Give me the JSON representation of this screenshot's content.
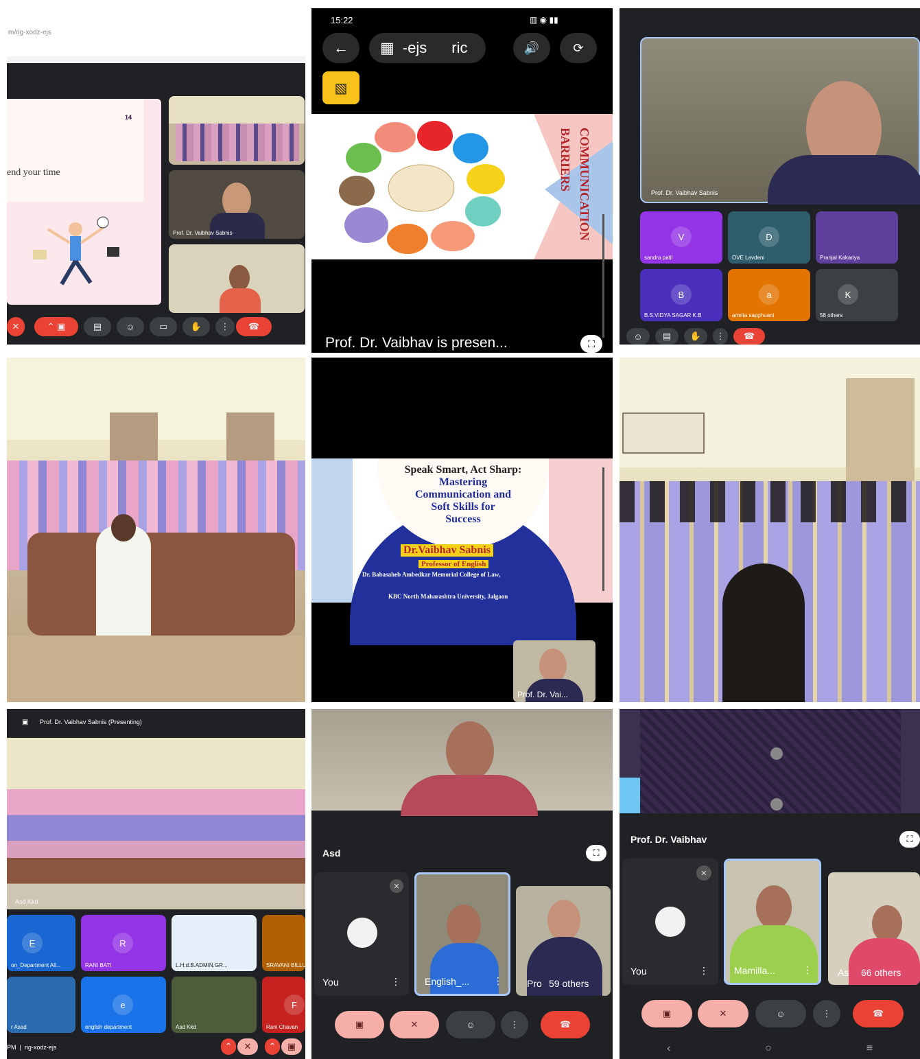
{
  "panel1": {
    "url_fragment": "m/rig-xodz-ejs",
    "slide_page": "14",
    "slide_text": "end your time",
    "tiles": [
      {
        "name": ""
      },
      {
        "name": "Prof. Dr. Vaibhav Sabnis"
      },
      {
        "name": ""
      }
    ]
  },
  "panel2": {
    "status_time": "15:22",
    "address_text": "-ejs",
    "address_text2": "ric",
    "slide_heading": "COMMUNICATION BARRIERS",
    "caption": "Prof. Dr. Vaibhav is presen..."
  },
  "panel3": {
    "main_speaker": "Prof. Dr. Vaibhav Sabnis",
    "participants": [
      {
        "initial": "V",
        "name": "sandra patil",
        "color": "#9334e6"
      },
      {
        "initial": "D",
        "name": "OVE Lavdeni",
        "color": "#2e5e6e"
      },
      {
        "initial": "",
        "name": "Pranjal Kakariya",
        "color": "#5f3f9c"
      },
      {
        "initial": "B",
        "name": "B.S.VIDYA SAGAR K.B",
        "color": "#4a2fbd"
      },
      {
        "initial": "a",
        "name": "amrita sapphuani",
        "color": "#e37400"
      },
      {
        "initial": "K",
        "name": "58 others",
        "color": "#3c4043"
      }
    ]
  },
  "panel5": {
    "title_line1": "Speak Smart, Act Sharp:",
    "title_line2": "Mastering",
    "title_line3": "Communication and",
    "title_line4": "Soft Skills for",
    "title_line5": "Success",
    "presenter": "Dr.Vaibhav Sabnis",
    "role": "Professor of English",
    "college": "Dr. Babasaheb Ambedkar Memorial College of Law,",
    "university": "KBC North Maharashtra University, Jalgaon",
    "pip_name": "Prof. Dr. Vai..."
  },
  "panel7": {
    "header": "Prof. Dr. Vaibhav Sabnis (Presenting)",
    "room_label": "Asd Kkd",
    "participants": [
      {
        "initial": "E",
        "name": "on_Department All...",
        "color": "#1967d2"
      },
      {
        "initial": "R",
        "name": "RANI BATI",
        "color": "#9334e6"
      },
      {
        "initial": "",
        "name": "L.H.d.B.ADMIN.GR...",
        "color": "#e6f0fa"
      },
      {
        "initial": "",
        "name": "SRAVANI BILLU",
        "color": "#b06000"
      },
      {
        "initial": "",
        "name": "r Asad",
        "color": "#2b6cb0"
      },
      {
        "initial": "e",
        "name": "english department",
        "color": "#1a73e8"
      },
      {
        "initial": "",
        "name": "Asd Kkd",
        "color": "#4e5e3a"
      },
      {
        "initial": "F",
        "name": "Rani Chavan",
        "color": "#c5221f"
      }
    ],
    "footer": "PM  |  rig-xodz-ejs"
  },
  "panel8": {
    "speaker": "Asd",
    "tiles": [
      {
        "name": "You"
      },
      {
        "name": "English_..."
      },
      {
        "name": "Pro",
        "extra": "59 others"
      }
    ]
  },
  "panel9": {
    "speaker": "Prof. Dr. Vaibhav",
    "tiles": [
      {
        "name": "You"
      },
      {
        "name": "Mamilla..."
      },
      {
        "name": "As",
        "extra": "66 others"
      }
    ]
  },
  "colors": {
    "meet_dark": "#202124",
    "meet_red": "#ea4335",
    "meet_pink": "#f6aea9",
    "uniform_lavender": "#a9a3e6",
    "uniform_pink": "#e8a7c5"
  }
}
